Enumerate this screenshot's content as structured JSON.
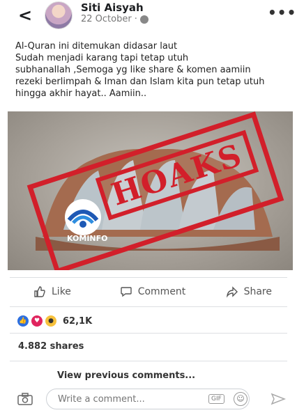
{
  "post": {
    "author": "Siti Aisyah",
    "date": "22 October",
    "dot": "·",
    "text": "Al-Quran  ini ditemukan didasar laut\nSudah menjadi karang tapi tetap utuh\nsubhanallah ,Semoga yg like share & komen aamiin\nrezeki berlimpah & Iman dan Islam kita pun tetap utuh\nhingga akhir hayat.. Aamiin..",
    "stamp_text": "HOAKS",
    "stamp_logo_text": "KOMINFO",
    "icons": [
      "back-arrow-icon",
      "avatar",
      "globe-icon",
      "more-options-icon"
    ]
  },
  "actions": {
    "like": "Like",
    "comment": "Comment",
    "share": "Share"
  },
  "stats": {
    "reactions_count": "62,1K",
    "shares": "4.882 shares",
    "reaction_types": [
      "like",
      "love",
      "wow"
    ]
  },
  "comments": {
    "view_previous": "View previous comments..."
  },
  "composer": {
    "placeholder": "Write a comment...",
    "gif_label": "GIF"
  },
  "colors": {
    "stamp_red": "#d21f2a",
    "like_blue": "#2d6fe0",
    "love_red": "#e0245e",
    "wow_yellow": "#f7c13c"
  }
}
